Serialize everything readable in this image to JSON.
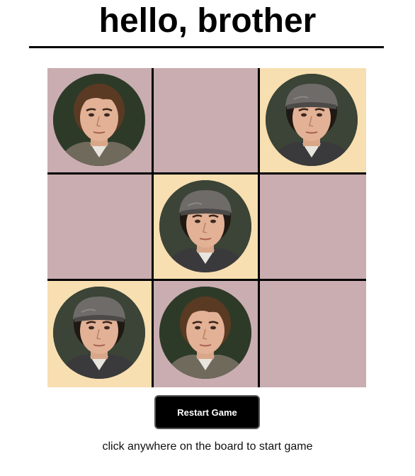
{
  "title": "hello, brother",
  "colors": {
    "cell_default": "#c9adb0",
    "cell_highlight": "#f7dfb1",
    "grid_line": "#000000",
    "button_bg": "#000000",
    "button_text": "#ffffff"
  },
  "board": {
    "cells": [
      {
        "piece": "stefan",
        "highlight": false
      },
      {
        "piece": "",
        "highlight": false
      },
      {
        "piece": "damon",
        "highlight": true
      },
      {
        "piece": "",
        "highlight": false
      },
      {
        "piece": "damon",
        "highlight": true
      },
      {
        "piece": "",
        "highlight": false
      },
      {
        "piece": "damon",
        "highlight": true
      },
      {
        "piece": "stefan",
        "highlight": false
      },
      {
        "piece": "",
        "highlight": false
      }
    ]
  },
  "restart_label": "Restart Game",
  "status_text": "click anywhere on the board to start game"
}
